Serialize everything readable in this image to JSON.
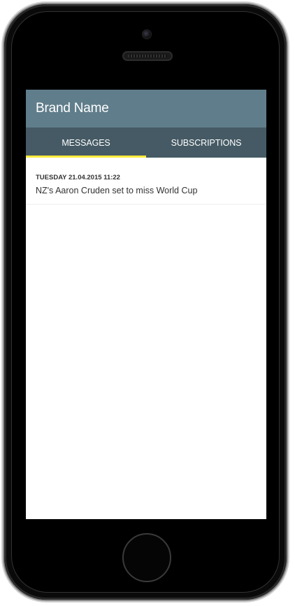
{
  "app": {
    "brand": "Brand Name"
  },
  "tabs": [
    {
      "label": "MESSAGES",
      "active": true
    },
    {
      "label": "SUBSCRIPTIONS",
      "active": false
    }
  ],
  "messages": [
    {
      "date": "TUESDAY 21.04.2015 11:22",
      "title": "NZ's Aaron Cruden set to miss World Cup"
    }
  ],
  "colors": {
    "app_bar": "#607d8b",
    "tab_bar": "#455a64",
    "tab_indicator": "#ffeb3b"
  }
}
